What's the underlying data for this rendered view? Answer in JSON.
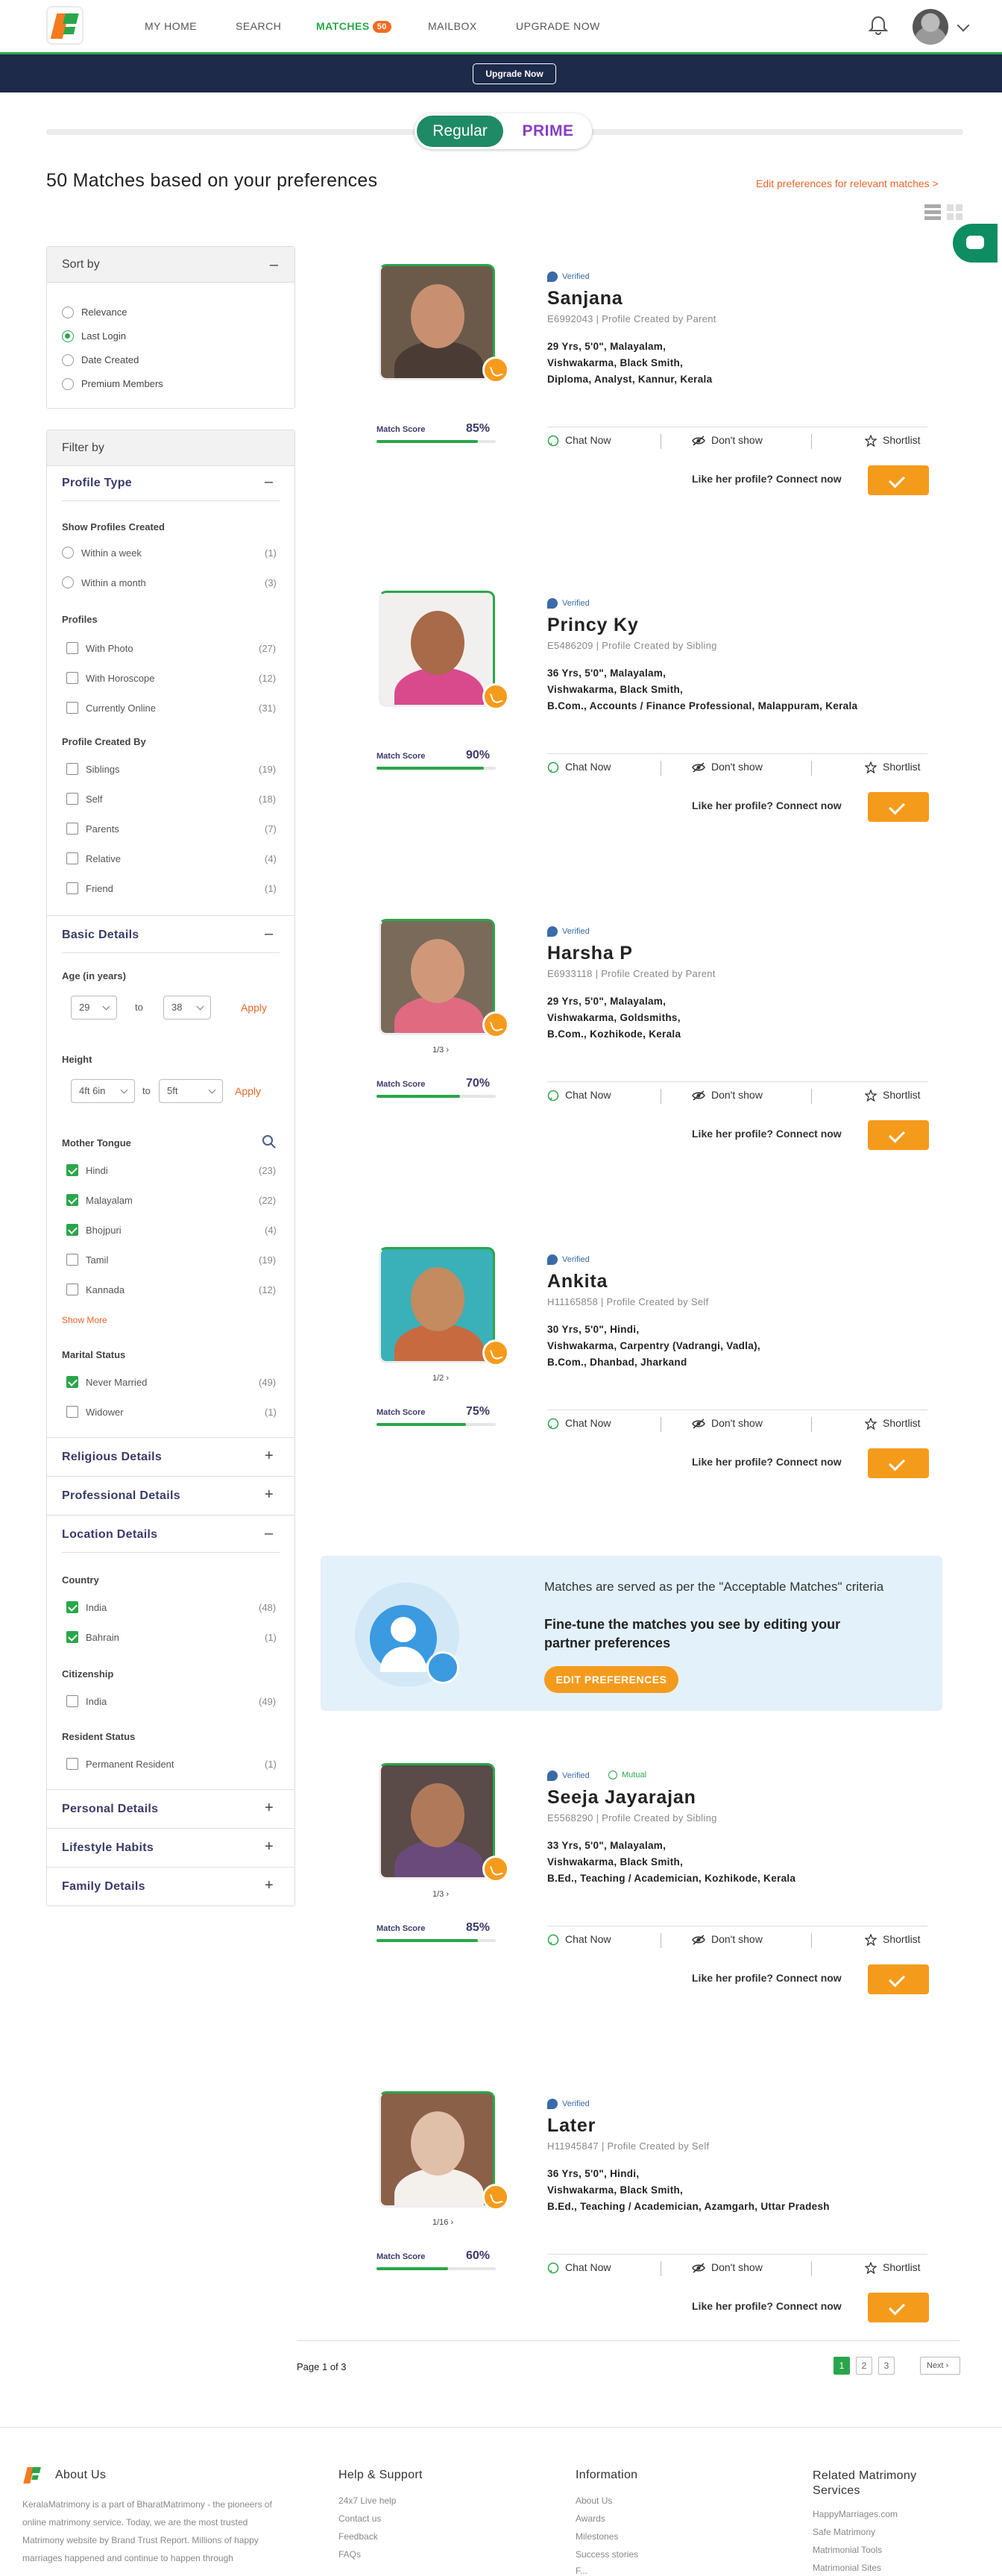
{
  "nav": {
    "items": [
      "MY HOME",
      "SEARCH",
      "MATCHES",
      "MAILBOX",
      "UPGRADE NOW"
    ],
    "matches_badge": "50",
    "upgrade_button": "Upgrade Now"
  },
  "toggle": {
    "regular": "Regular",
    "prime": "PRIME"
  },
  "main": {
    "title": "50 Matches based on your preferences",
    "edit_link": "Edit preferences for relevant matches >"
  },
  "sort": {
    "title": "Sort by",
    "collapse": "–",
    "options": [
      "Relevance",
      "Last Login",
      "Date Created",
      "Premium Members"
    ],
    "selected": "Last Login"
  },
  "filter": {
    "title": "Filter by",
    "profile_type": {
      "title": "Profile Type",
      "collapse": "–",
      "created_label": "Show Profiles Created",
      "created": [
        {
          "label": "Within a week",
          "count": "(1)"
        },
        {
          "label": "Within a month",
          "count": "(3)"
        }
      ],
      "profiles_label": "Profiles",
      "profiles": [
        {
          "label": "With Photo",
          "count": "(27)"
        },
        {
          "label": "With Horoscope",
          "count": "(12)"
        },
        {
          "label": "Currently Online",
          "count": "(31)"
        }
      ],
      "created_by_label": "Profile Created By",
      "created_by": [
        {
          "label": "Siblings",
          "count": "(19)"
        },
        {
          "label": "Self",
          "count": "(18)"
        },
        {
          "label": "Parents",
          "count": "(7)"
        },
        {
          "label": "Relative",
          "count": "(4)"
        },
        {
          "label": "Friend",
          "count": "(1)"
        }
      ]
    },
    "basic": {
      "title": "Basic Details",
      "collapse": "–",
      "age_label": "Age (in years)",
      "age_from": "29",
      "age_to": "38",
      "to": "to",
      "apply": "Apply",
      "height_label": "Height",
      "height_from": "4ft 6in",
      "height_to": "5ft",
      "mother_tongue_label": "Mother Tongue",
      "tongues": [
        {
          "label": "Hindi",
          "count": "(23)",
          "checked": true
        },
        {
          "label": "Malayalam",
          "count": "(22)",
          "checked": true
        },
        {
          "label": "Bhojpuri",
          "count": "(4)",
          "checked": true
        },
        {
          "label": "Tamil",
          "count": "(19)",
          "checked": false
        },
        {
          "label": "Kannada",
          "count": "(12)",
          "checked": false
        }
      ],
      "show_more": "Show More",
      "marital_label": "Marital Status",
      "marital": [
        {
          "label": "Never Married",
          "count": "(49)",
          "checked": true
        },
        {
          "label": "Widower",
          "count": "(1)",
          "checked": false
        }
      ]
    },
    "religious": {
      "title": "Religious Details",
      "expand": "+"
    },
    "professional": {
      "title": "Professional Details",
      "expand": "+"
    },
    "location": {
      "title": "Location Details",
      "collapse": "–",
      "country_label": "Country",
      "countries": [
        {
          "label": "India",
          "count": "(48)",
          "checked": true
        },
        {
          "label": "Bahrain",
          "count": "(1)",
          "checked": true
        }
      ],
      "citizenship_label": "Citizenship",
      "citizenship": [
        {
          "label": "India",
          "count": "(49)",
          "checked": false
        }
      ],
      "resident_label": "Resident Status",
      "resident": [
        {
          "label": "Permanent Resident",
          "count": "(1)",
          "checked": false
        }
      ]
    },
    "personal": {
      "title": "Personal Details",
      "expand": "+"
    },
    "lifestyle": {
      "title": "Lifestyle Habits",
      "expand": "+"
    },
    "family": {
      "title": "Family Details",
      "expand": "+"
    }
  },
  "card_labels": {
    "verified": "Verified",
    "mutual": "Mutual",
    "match_score": "Match Score",
    "chat": "Chat Now",
    "dont_show": "Don't show",
    "shortlist": "Shortlist",
    "like": "Like her profile?",
    "connect": "Connect now"
  },
  "profiles": [
    {
      "name": "Sanjana",
      "id_line": "E6992043 | Profile Created by Parent",
      "line1": "29 Yrs,  5'0\",  Malayalam,",
      "line2": "Vishwakarma,  Black Smith,",
      "line3": "Diploma,  Analyst,  Kannur,  Kerala",
      "score": "85%",
      "score_value": 85,
      "pager": "",
      "mutual": false
    },
    {
      "name": "Princy Ky",
      "id_line": "E5486209 | Profile Created by Sibling",
      "line1": "36 Yrs,  5'0\",  Malayalam,",
      "line2": "Vishwakarma,  Black Smith,",
      "line3": "B.Com.,  Accounts / Finance Professional,  Malappuram,  Kerala",
      "score": "90%",
      "score_value": 90,
      "pager": "",
      "mutual": false
    },
    {
      "name": "Harsha P",
      "id_line": "E6933118 | Profile Created by Parent",
      "line1": "29 Yrs,  5'0\",  Malayalam,",
      "line2": "Vishwakarma,  Goldsmiths,",
      "line3": "B.Com.,  Kozhikode,  Kerala",
      "score": "70%",
      "score_value": 70,
      "pager": "1/3 ›",
      "mutual": false
    },
    {
      "name": "Ankita",
      "id_line": "H11165858 | Profile Created by Self",
      "line1": "30 Yrs,  5'0\",  Hindi,",
      "line2": "Vishwakarma,  Carpentry (Vadrangi, Vadla),",
      "line3": "B.Com.,  Dhanbad,  Jharkand",
      "score": "75%",
      "score_value": 75,
      "pager": "1/2 ›",
      "mutual": false
    },
    {
      "name": "Seeja Jayarajan",
      "id_line": "E5568290 | Profile Created by Sibling",
      "line1": "33 Yrs,  5'0\",  Malayalam,",
      "line2": "Vishwakarma,  Black Smith,",
      "line3": "B.Ed.,  Teaching / Academician,  Kozhikode,  Kerala",
      "score": "85%",
      "score_value": 85,
      "pager": "1/3 ›",
      "mutual": true
    },
    {
      "name": "Later",
      "id_line": "H11945847 | Profile Created by Self",
      "line1": "36 Yrs,  5'0\",  Hindi,",
      "line2": "Vishwakarma,  Black Smith,",
      "line3": "B.Ed.,  Teaching / Academician,  Azamgarh,  Uttar Pradesh",
      "score": "60%",
      "score_value": 60,
      "pager": "1/16 ›",
      "mutual": false
    }
  ],
  "banner": {
    "line1": "Matches are served as per the \"Acceptable Matches\" criteria",
    "line2": "Fine-tune the matches you see by editing your partner preferences",
    "button": "EDIT PREFERENCES"
  },
  "pagination": {
    "label": "Page 1 of 3",
    "pages": [
      "1",
      "2",
      "3"
    ],
    "next": "Next ›"
  },
  "footer": {
    "about_title": "About Us",
    "about_text": "KeralaMatrimony is a part of BharatMatrimony - the pioneers of online matrimony service. Today, we are the most trusted Matrimony website by Brand Trust Report. Millions of happy marriages happened and continue to happen through",
    "help_title": "Help & Support",
    "help_links": [
      "24x7 Live help",
      "Contact us",
      "Feedback",
      "FAQs"
    ],
    "info_title": "Information",
    "info_links": [
      "About Us",
      "Awards",
      "Milestones",
      "Success stories",
      "F..."
    ],
    "related_title": "Related Matrimony Services",
    "related_links": [
      "HappyMarriages.com",
      "Safe Matrimony",
      "Matrimonial Tools",
      "Matrimonial Sites"
    ]
  },
  "colors": {
    "accent": "#2aa64a",
    "orange": "#f59b1c",
    "navy": "#1e2a4a",
    "link": "#e8652a"
  }
}
